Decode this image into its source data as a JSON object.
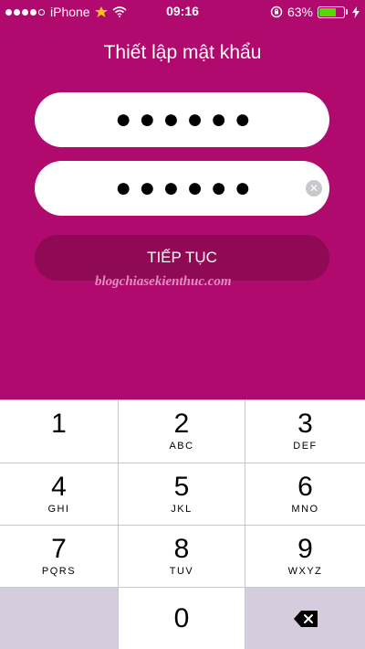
{
  "status_bar": {
    "carrier": "iPhone",
    "time": "09:16",
    "battery_percent": "63%",
    "battery_level": 0.63,
    "signal_bars_filled": 4,
    "signal_bars_total": 5
  },
  "screen": {
    "title": "Thiết lập mật khẩu",
    "password_mask": "●●●●●●",
    "confirm_mask": "●●●●●●",
    "continue_label": "TIẾP TỤC",
    "watermark": "blogchiasekienthuc.com"
  },
  "keypad": {
    "keys": [
      {
        "digit": "1",
        "letters": ""
      },
      {
        "digit": "2",
        "letters": "ABC"
      },
      {
        "digit": "3",
        "letters": "DEF"
      },
      {
        "digit": "4",
        "letters": "GHI"
      },
      {
        "digit": "5",
        "letters": "JKL"
      },
      {
        "digit": "6",
        "letters": "MNO"
      },
      {
        "digit": "7",
        "letters": "PQRS"
      },
      {
        "digit": "8",
        "letters": "TUV"
      },
      {
        "digit": "9",
        "letters": "WXYZ"
      },
      {
        "digit": "0",
        "letters": ""
      }
    ]
  },
  "colors": {
    "background": "#b10a6e",
    "button": "#8f0954",
    "battery": "#55d900"
  },
  "icons": {
    "wifi": "wifi-icon",
    "orientation_lock": "orientation-lock-icon",
    "charging": "charging-bolt-icon",
    "clear": "clear-icon",
    "backspace": "backspace-icon"
  }
}
